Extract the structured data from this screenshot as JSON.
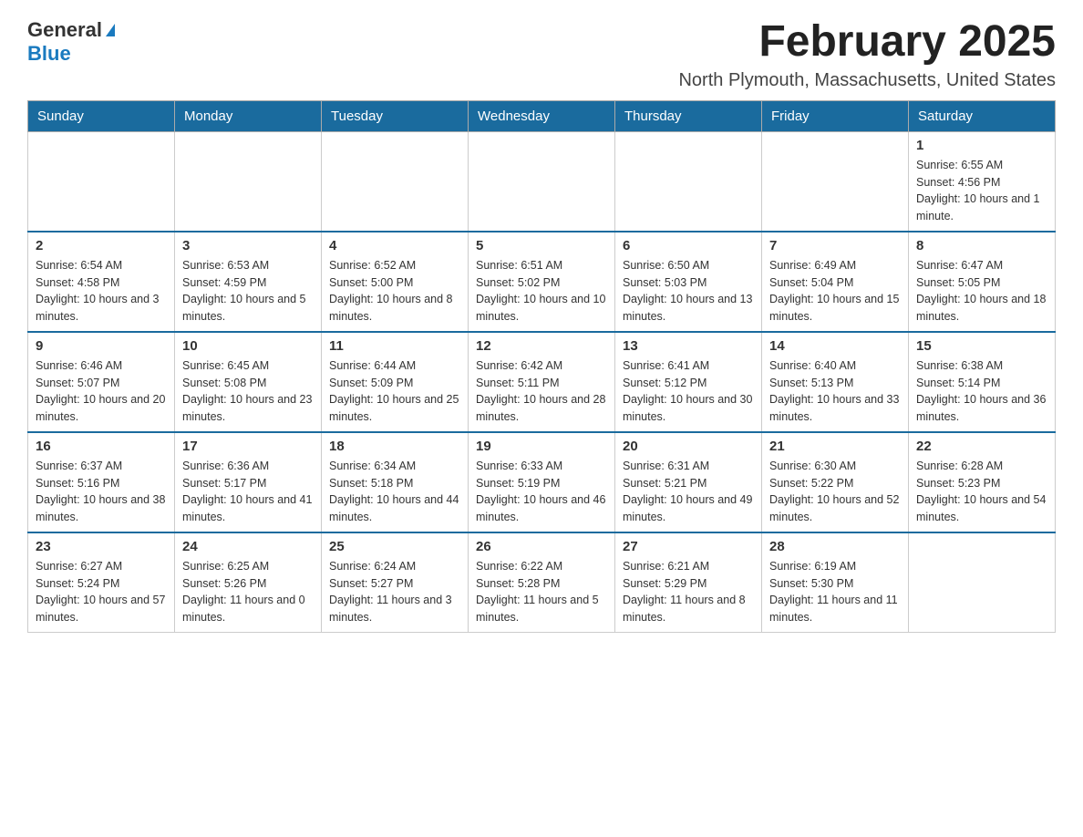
{
  "logo": {
    "general": "General",
    "blue": "Blue"
  },
  "title": "February 2025",
  "location": "North Plymouth, Massachusetts, United States",
  "weekdays": [
    "Sunday",
    "Monday",
    "Tuesday",
    "Wednesday",
    "Thursday",
    "Friday",
    "Saturday"
  ],
  "weeks": [
    [
      {
        "day": "",
        "sunrise": "",
        "sunset": "",
        "daylight": ""
      },
      {
        "day": "",
        "sunrise": "",
        "sunset": "",
        "daylight": ""
      },
      {
        "day": "",
        "sunrise": "",
        "sunset": "",
        "daylight": ""
      },
      {
        "day": "",
        "sunrise": "",
        "sunset": "",
        "daylight": ""
      },
      {
        "day": "",
        "sunrise": "",
        "sunset": "",
        "daylight": ""
      },
      {
        "day": "",
        "sunrise": "",
        "sunset": "",
        "daylight": ""
      },
      {
        "day": "1",
        "sunrise": "Sunrise: 6:55 AM",
        "sunset": "Sunset: 4:56 PM",
        "daylight": "Daylight: 10 hours and 1 minute."
      }
    ],
    [
      {
        "day": "2",
        "sunrise": "Sunrise: 6:54 AM",
        "sunset": "Sunset: 4:58 PM",
        "daylight": "Daylight: 10 hours and 3 minutes."
      },
      {
        "day": "3",
        "sunrise": "Sunrise: 6:53 AM",
        "sunset": "Sunset: 4:59 PM",
        "daylight": "Daylight: 10 hours and 5 minutes."
      },
      {
        "day": "4",
        "sunrise": "Sunrise: 6:52 AM",
        "sunset": "Sunset: 5:00 PM",
        "daylight": "Daylight: 10 hours and 8 minutes."
      },
      {
        "day": "5",
        "sunrise": "Sunrise: 6:51 AM",
        "sunset": "Sunset: 5:02 PM",
        "daylight": "Daylight: 10 hours and 10 minutes."
      },
      {
        "day": "6",
        "sunrise": "Sunrise: 6:50 AM",
        "sunset": "Sunset: 5:03 PM",
        "daylight": "Daylight: 10 hours and 13 minutes."
      },
      {
        "day": "7",
        "sunrise": "Sunrise: 6:49 AM",
        "sunset": "Sunset: 5:04 PM",
        "daylight": "Daylight: 10 hours and 15 minutes."
      },
      {
        "day": "8",
        "sunrise": "Sunrise: 6:47 AM",
        "sunset": "Sunset: 5:05 PM",
        "daylight": "Daylight: 10 hours and 18 minutes."
      }
    ],
    [
      {
        "day": "9",
        "sunrise": "Sunrise: 6:46 AM",
        "sunset": "Sunset: 5:07 PM",
        "daylight": "Daylight: 10 hours and 20 minutes."
      },
      {
        "day": "10",
        "sunrise": "Sunrise: 6:45 AM",
        "sunset": "Sunset: 5:08 PM",
        "daylight": "Daylight: 10 hours and 23 minutes."
      },
      {
        "day": "11",
        "sunrise": "Sunrise: 6:44 AM",
        "sunset": "Sunset: 5:09 PM",
        "daylight": "Daylight: 10 hours and 25 minutes."
      },
      {
        "day": "12",
        "sunrise": "Sunrise: 6:42 AM",
        "sunset": "Sunset: 5:11 PM",
        "daylight": "Daylight: 10 hours and 28 minutes."
      },
      {
        "day": "13",
        "sunrise": "Sunrise: 6:41 AM",
        "sunset": "Sunset: 5:12 PM",
        "daylight": "Daylight: 10 hours and 30 minutes."
      },
      {
        "day": "14",
        "sunrise": "Sunrise: 6:40 AM",
        "sunset": "Sunset: 5:13 PM",
        "daylight": "Daylight: 10 hours and 33 minutes."
      },
      {
        "day": "15",
        "sunrise": "Sunrise: 6:38 AM",
        "sunset": "Sunset: 5:14 PM",
        "daylight": "Daylight: 10 hours and 36 minutes."
      }
    ],
    [
      {
        "day": "16",
        "sunrise": "Sunrise: 6:37 AM",
        "sunset": "Sunset: 5:16 PM",
        "daylight": "Daylight: 10 hours and 38 minutes."
      },
      {
        "day": "17",
        "sunrise": "Sunrise: 6:36 AM",
        "sunset": "Sunset: 5:17 PM",
        "daylight": "Daylight: 10 hours and 41 minutes."
      },
      {
        "day": "18",
        "sunrise": "Sunrise: 6:34 AM",
        "sunset": "Sunset: 5:18 PM",
        "daylight": "Daylight: 10 hours and 44 minutes."
      },
      {
        "day": "19",
        "sunrise": "Sunrise: 6:33 AM",
        "sunset": "Sunset: 5:19 PM",
        "daylight": "Daylight: 10 hours and 46 minutes."
      },
      {
        "day": "20",
        "sunrise": "Sunrise: 6:31 AM",
        "sunset": "Sunset: 5:21 PM",
        "daylight": "Daylight: 10 hours and 49 minutes."
      },
      {
        "day": "21",
        "sunrise": "Sunrise: 6:30 AM",
        "sunset": "Sunset: 5:22 PM",
        "daylight": "Daylight: 10 hours and 52 minutes."
      },
      {
        "day": "22",
        "sunrise": "Sunrise: 6:28 AM",
        "sunset": "Sunset: 5:23 PM",
        "daylight": "Daylight: 10 hours and 54 minutes."
      }
    ],
    [
      {
        "day": "23",
        "sunrise": "Sunrise: 6:27 AM",
        "sunset": "Sunset: 5:24 PM",
        "daylight": "Daylight: 10 hours and 57 minutes."
      },
      {
        "day": "24",
        "sunrise": "Sunrise: 6:25 AM",
        "sunset": "Sunset: 5:26 PM",
        "daylight": "Daylight: 11 hours and 0 minutes."
      },
      {
        "day": "25",
        "sunrise": "Sunrise: 6:24 AM",
        "sunset": "Sunset: 5:27 PM",
        "daylight": "Daylight: 11 hours and 3 minutes."
      },
      {
        "day": "26",
        "sunrise": "Sunrise: 6:22 AM",
        "sunset": "Sunset: 5:28 PM",
        "daylight": "Daylight: 11 hours and 5 minutes."
      },
      {
        "day": "27",
        "sunrise": "Sunrise: 6:21 AM",
        "sunset": "Sunset: 5:29 PM",
        "daylight": "Daylight: 11 hours and 8 minutes."
      },
      {
        "day": "28",
        "sunrise": "Sunrise: 6:19 AM",
        "sunset": "Sunset: 5:30 PM",
        "daylight": "Daylight: 11 hours and 11 minutes."
      },
      {
        "day": "",
        "sunrise": "",
        "sunset": "",
        "daylight": ""
      }
    ]
  ]
}
